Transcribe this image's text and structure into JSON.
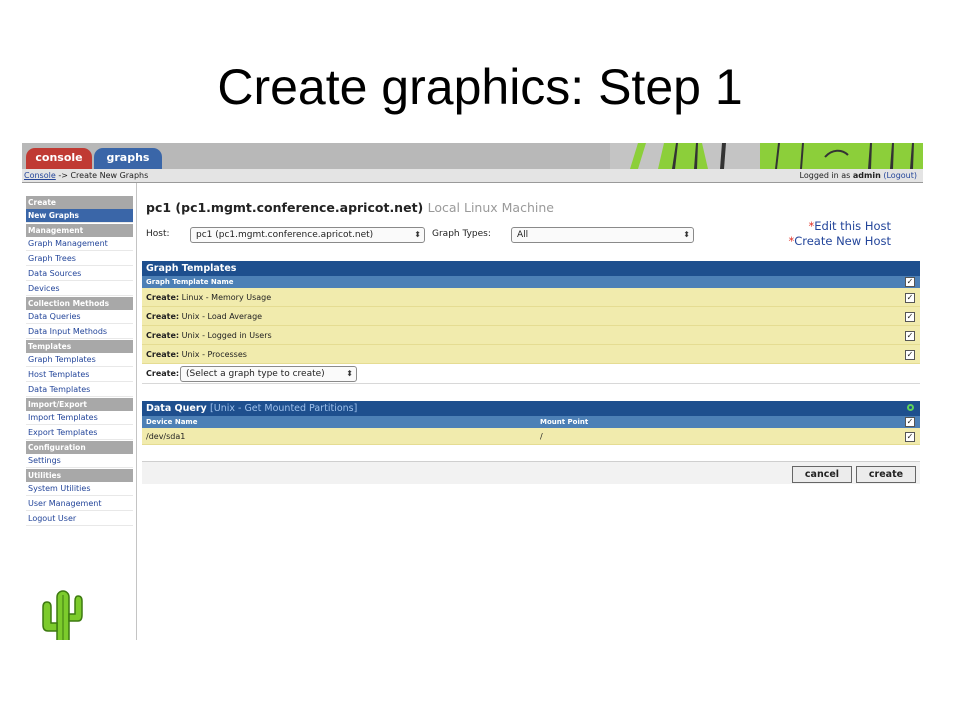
{
  "slide": {
    "title": "Create graphics: Step 1"
  },
  "tabs": [
    {
      "label": "console"
    },
    {
      "label": "graphs"
    }
  ],
  "breadcrumb": {
    "root": "Console",
    "separator": "->",
    "current": "Create New Graphs"
  },
  "login": {
    "prefix": "Logged in as",
    "user": "admin",
    "logout": "(Logout)"
  },
  "sidebar": {
    "sections": [
      {
        "header": "Create",
        "items": [
          "New Graphs"
        ]
      },
      {
        "header": "Management",
        "items": [
          "Graph Management",
          "Graph Trees",
          "Data Sources",
          "Devices"
        ]
      },
      {
        "header": "Collection Methods",
        "items": [
          "Data Queries",
          "Data Input Methods"
        ]
      },
      {
        "header": "Templates",
        "items": [
          "Graph Templates",
          "Host Templates",
          "Data Templates"
        ]
      },
      {
        "header": "Import/Export",
        "items": [
          "Import Templates",
          "Export Templates"
        ]
      },
      {
        "header": "Configuration",
        "items": [
          "Settings"
        ]
      },
      {
        "header": "Utilities",
        "items": [
          "System Utilities",
          "User Management",
          "Logout User"
        ]
      }
    ]
  },
  "host": {
    "title": "pc1 (pc1.mgmt.conference.apricot.net)",
    "description": "Local Linux Machine",
    "host_label": "Host:",
    "host_value": "pc1 (pc1.mgmt.conference.apricot.net)",
    "graph_types_label": "Graph Types:",
    "graph_types_value": "All",
    "edit_link": "Edit this Host",
    "create_link": "Create New Host",
    "star": "*"
  },
  "graph_templates": {
    "title": "Graph Templates",
    "column": "Graph Template Name",
    "create_prefix": "Create:",
    "rows": [
      "Linux - Memory Usage",
      "Unix - Load Average",
      "Unix - Logged in Users",
      "Unix - Processes"
    ],
    "create_label": "Create:",
    "create_select": "(Select a graph type to create)"
  },
  "data_query": {
    "title": "Data Query",
    "subtitle": "[Unix - Get Mounted Partitions]",
    "columns": [
      "Device Name",
      "Mount Point"
    ],
    "rows": [
      {
        "device": "/dev/sda1",
        "mount": "/"
      }
    ]
  },
  "buttons": {
    "cancel": "cancel",
    "create": "create"
  },
  "icons": {
    "check": "✓",
    "dropdown": "⬍"
  },
  "colors": {
    "header_blue": "#1e4f8e",
    "column_blue": "#4d80b6",
    "row_yellow": "#f1ebad",
    "console_tab": "#c03a33",
    "graphs_tab": "#3a66a8",
    "link_blue": "#23459a"
  }
}
